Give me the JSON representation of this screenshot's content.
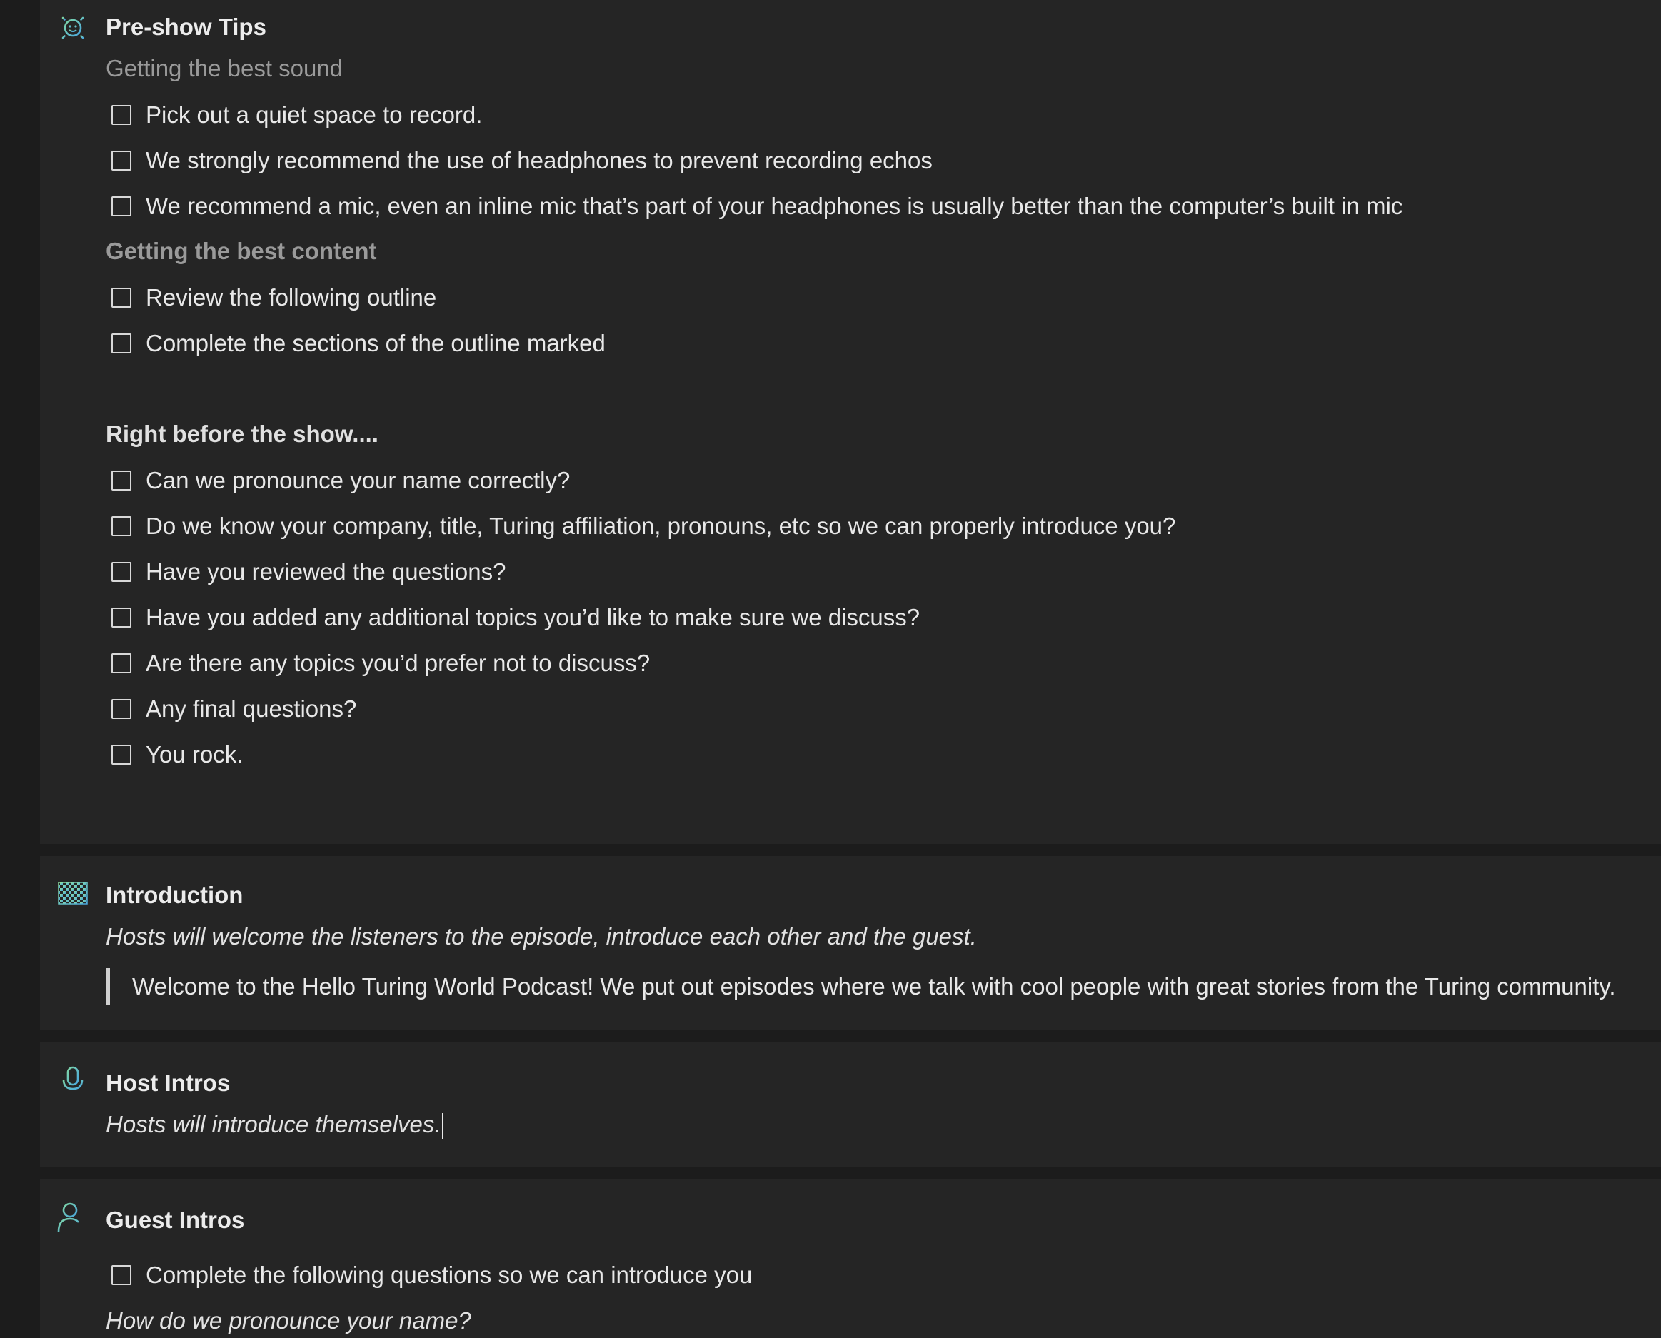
{
  "sections": {
    "preshow": {
      "title": "Pre-show Tips",
      "icon": "sun-face-icon",
      "sub_sound": "Getting the best sound",
      "sound_items": [
        "Pick out a quiet space to record.",
        "We strongly recommend the use of headphones to prevent recording echos",
        "We recommend a mic, even an inline mic that’s part of your headphones is usually better than the computer’s built in mic"
      ],
      "sub_content": "Getting the best content",
      "content_items": [
        "Review the following outline",
        "Complete the sections of the outline marked"
      ],
      "heading_before": "Right before the show....",
      "before_items": [
        "Can we pronounce your name correctly?",
        "Do we know your company, title, Turing affiliation, pronouns, etc so we can properly introduce you?",
        "Have you reviewed the questions?",
        "Have you added any additional topics you’d like to make sure we discuss?",
        "Are there any topics you’d prefer not to discuss?",
        "Any final questions?",
        "You rock."
      ]
    },
    "introduction": {
      "title": "Introduction",
      "icon": "checkered-flag-icon",
      "description": "Hosts will welcome the listeners to the episode, introduce each other and the guest.",
      "quote": "Welcome to the Hello Turing World Podcast! We put out episodes where we talk with cool people with great stories from the Turing community."
    },
    "host_intros": {
      "title": "Host Intros",
      "icon": "microphone-icon",
      "description": "Hosts will introduce themselves."
    },
    "guest_intros": {
      "title": "Guest Intros",
      "icon": "add-person-icon",
      "checklist": "Complete the following questions so we can introduce you",
      "question": "How do we pronounce your name?"
    }
  },
  "colors": {
    "background": "#1c1c1c",
    "block": "#252525",
    "icon_accent": "#5ec4c8"
  }
}
